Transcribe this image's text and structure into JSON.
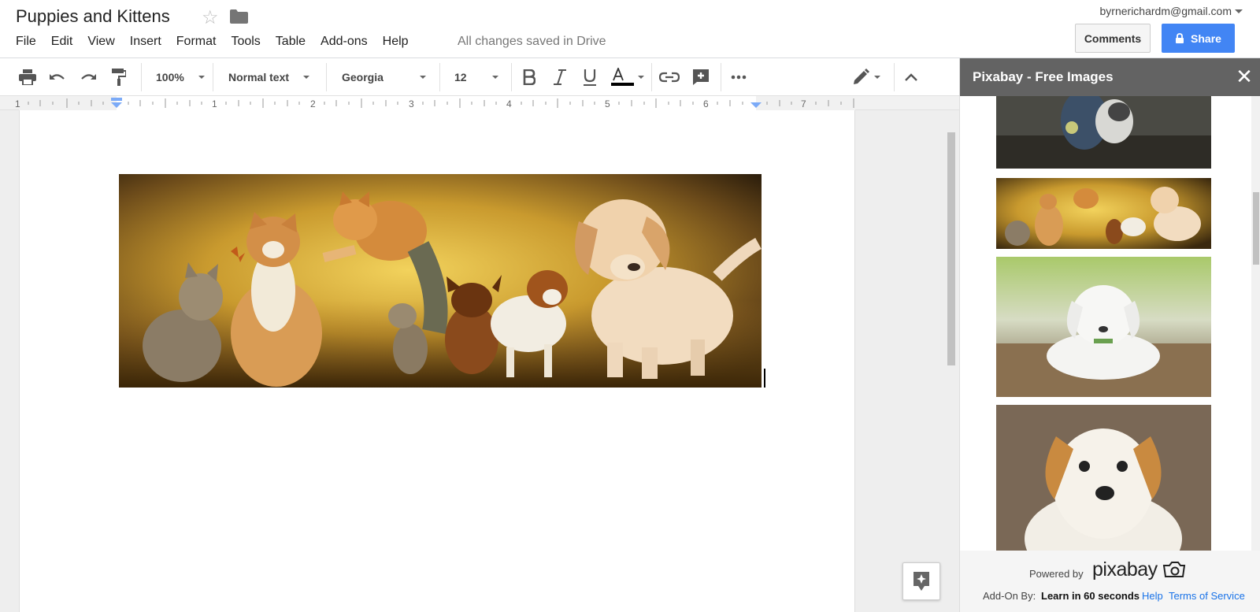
{
  "doc": {
    "title": "Puppies and Kittens",
    "save_status": "All changes saved in Drive"
  },
  "account": {
    "email": "byrnerichardm@gmail.com"
  },
  "menu": [
    "File",
    "Edit",
    "View",
    "Insert",
    "Format",
    "Tools",
    "Table",
    "Add-ons",
    "Help"
  ],
  "buttons": {
    "comments": "Comments",
    "share": "Share"
  },
  "toolbar": {
    "zoom": "100%",
    "style": "Normal text",
    "font": "Georgia",
    "size": "12"
  },
  "ruler": {
    "marks": [
      "1",
      "1",
      "2",
      "3",
      "4",
      "5",
      "6",
      "7"
    ]
  },
  "sidepanel": {
    "title": "Pixabay - Free Images",
    "powered_by": "Powered by",
    "logo_text": "pixabay",
    "addon_by": "Add-On By:",
    "learn_brand": "Learn in 60 seconds",
    "help": "Help",
    "terms": "Terms of Service"
  },
  "colors": {
    "share_blue": "#4285f4",
    "panel_header": "#636363",
    "link_blue": "#1a73e8"
  }
}
